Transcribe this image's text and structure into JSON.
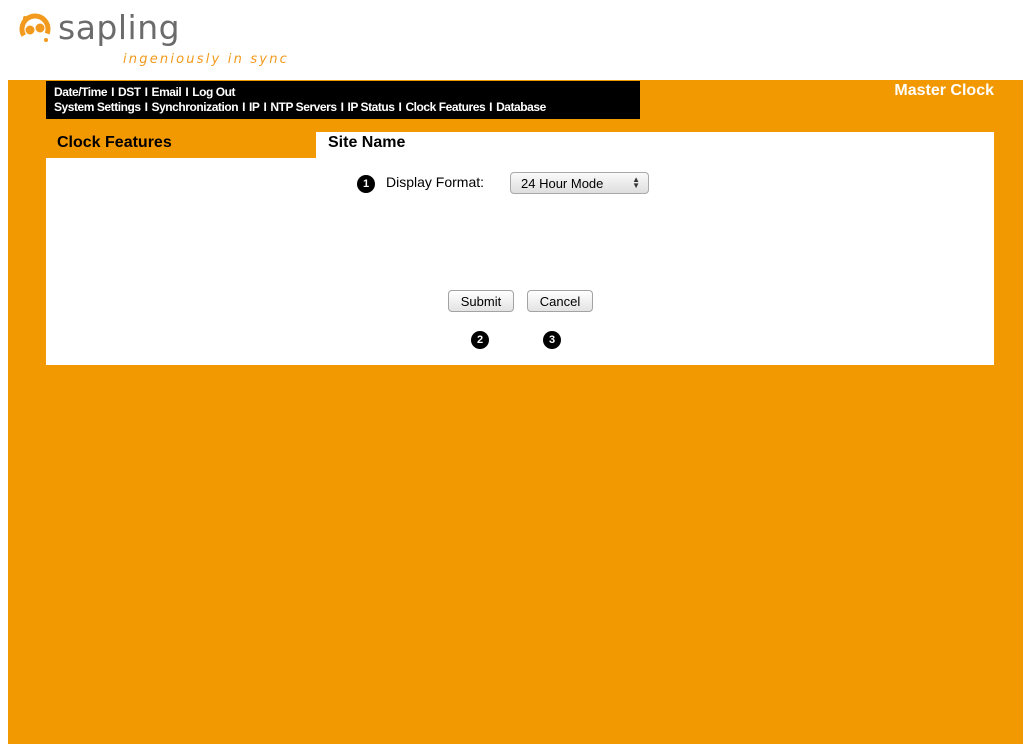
{
  "brand": {
    "name": "sapling",
    "tagline": "ingeniously in sync",
    "accent": "#f29800"
  },
  "nav": {
    "row1": [
      "Date/Time",
      "DST",
      "Email",
      "Log Out"
    ],
    "row2": [
      "System Settings",
      "Synchronization",
      "IP",
      "NTP Servers",
      "IP Status",
      "Clock Features",
      "Database"
    ],
    "separator": "I"
  },
  "header": {
    "title": "Master Clock"
  },
  "sidebar": {
    "title": "Clock Features"
  },
  "panel": {
    "title": "Site Name"
  },
  "form": {
    "display_format_label": "Display Format:",
    "display_format_value": "24 Hour Mode",
    "submit_label": "Submit",
    "cancel_label": "Cancel"
  },
  "callouts": {
    "one": "1",
    "two": "2",
    "three": "3"
  }
}
